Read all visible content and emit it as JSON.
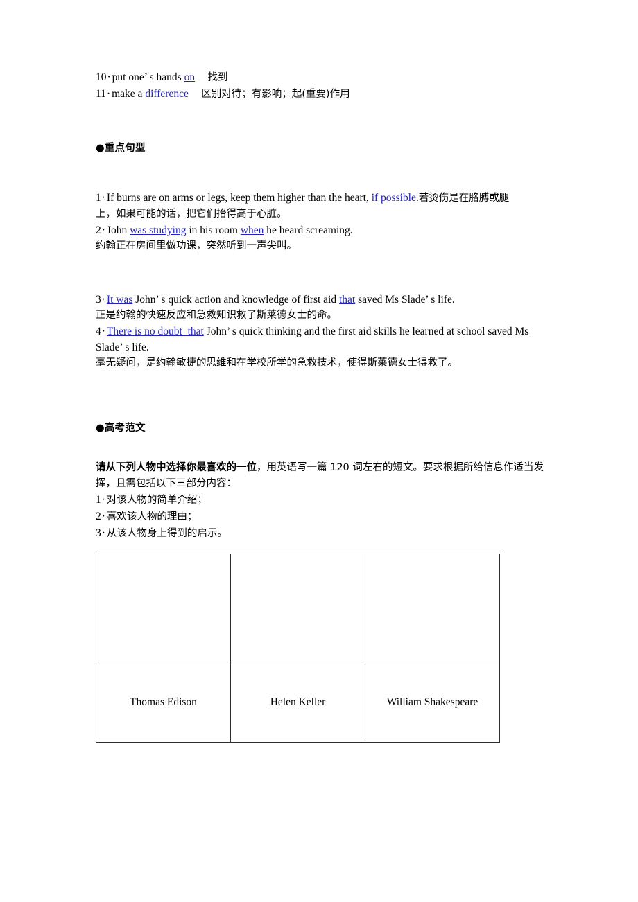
{
  "phrases": {
    "items": [
      {
        "num": "10",
        "sep": "·",
        "pre": "put one’ s hands ",
        "key": "on",
        "post": "",
        "gloss": "找到"
      },
      {
        "num": "11",
        "sep": "·",
        "pre": "make a ",
        "key": "difference",
        "post": "",
        "gloss": "区别对待；有影响；起(重要)作用"
      }
    ]
  },
  "sections": {
    "key_sentences_heading": "●重点句型",
    "essay_heading": "●高考范文"
  },
  "key_sentences": [
    {
      "num": "1",
      "sep": "·",
      "seg": [
        {
          "t": "If burns are on arms or legs, keep them higher than the heart, ",
          "k": false
        },
        {
          "t": "if possible",
          "k": true
        },
        {
          "t": ".",
          "k": false
        },
        {
          "t": "若烫伤是在胳膊或腿",
          "k": false,
          "cn": true
        }
      ],
      "translation": "上，如果可能的话，把它们抬得高于心脏。"
    },
    {
      "num": "2",
      "sep": "·",
      "seg": [
        {
          "t": "John ",
          "k": false
        },
        {
          "t": "was studying",
          "k": true
        },
        {
          "t": " in his room ",
          "k": false
        },
        {
          "t": "when",
          "k": true
        },
        {
          "t": " he heard screaming.",
          "k": false
        }
      ],
      "translation": "约翰正在房间里做功课，突然听到一声尖叫。"
    },
    {
      "num": "3",
      "sep": "·",
      "seg": [
        {
          "t": "It was",
          "k": true
        },
        {
          "t": " John’ s quick action and knowledge of first aid ",
          "k": false
        },
        {
          "t": "that",
          "k": true
        },
        {
          "t": " saved Ms Slade’ s life.",
          "k": false
        }
      ],
      "translation": "正是约翰的快速反应和急救知识救了斯莱德女士的命。"
    },
    {
      "num": "4",
      "sep": "·",
      "seg": [
        {
          "t": "There is no doubt_that",
          "k": true
        },
        {
          "t": " John’ s quick thinking and the first aid skills he learned at school saved Ms Slade’ s life.",
          "k": false
        }
      ],
      "translation": "毫无疑问，是约翰敏捷的思维和在学校所学的急救技术，使得斯莱德女士得救了。"
    }
  ],
  "essay": {
    "prompt_bold": "请从下列人物中选择你最喜欢的一位",
    "prompt_rest": "，用英语写一篇 120 词左右的短文。要求根据所给信息作适当发挥，且需包括以下三部分内容：",
    "requirements": [
      {
        "num": "1",
        "sep": "·",
        "text": "对该人物的简单介绍；"
      },
      {
        "num": "2",
        "sep": "·",
        "text": "喜欢该人物的理由；"
      },
      {
        "num": "3",
        "sep": "·",
        "text": "从该人物身上得到的启示。"
      }
    ]
  },
  "figure_table": {
    "image_cells": [
      "",
      "",
      ""
    ],
    "names": [
      "Thomas Edison",
      "Helen Keller",
      "William Shakespeare"
    ]
  },
  "colors": {
    "link_blue": "#2323b4",
    "text_black": "#000000",
    "table_border": "#2e2e2e",
    "page_background": "#ffffff"
  }
}
